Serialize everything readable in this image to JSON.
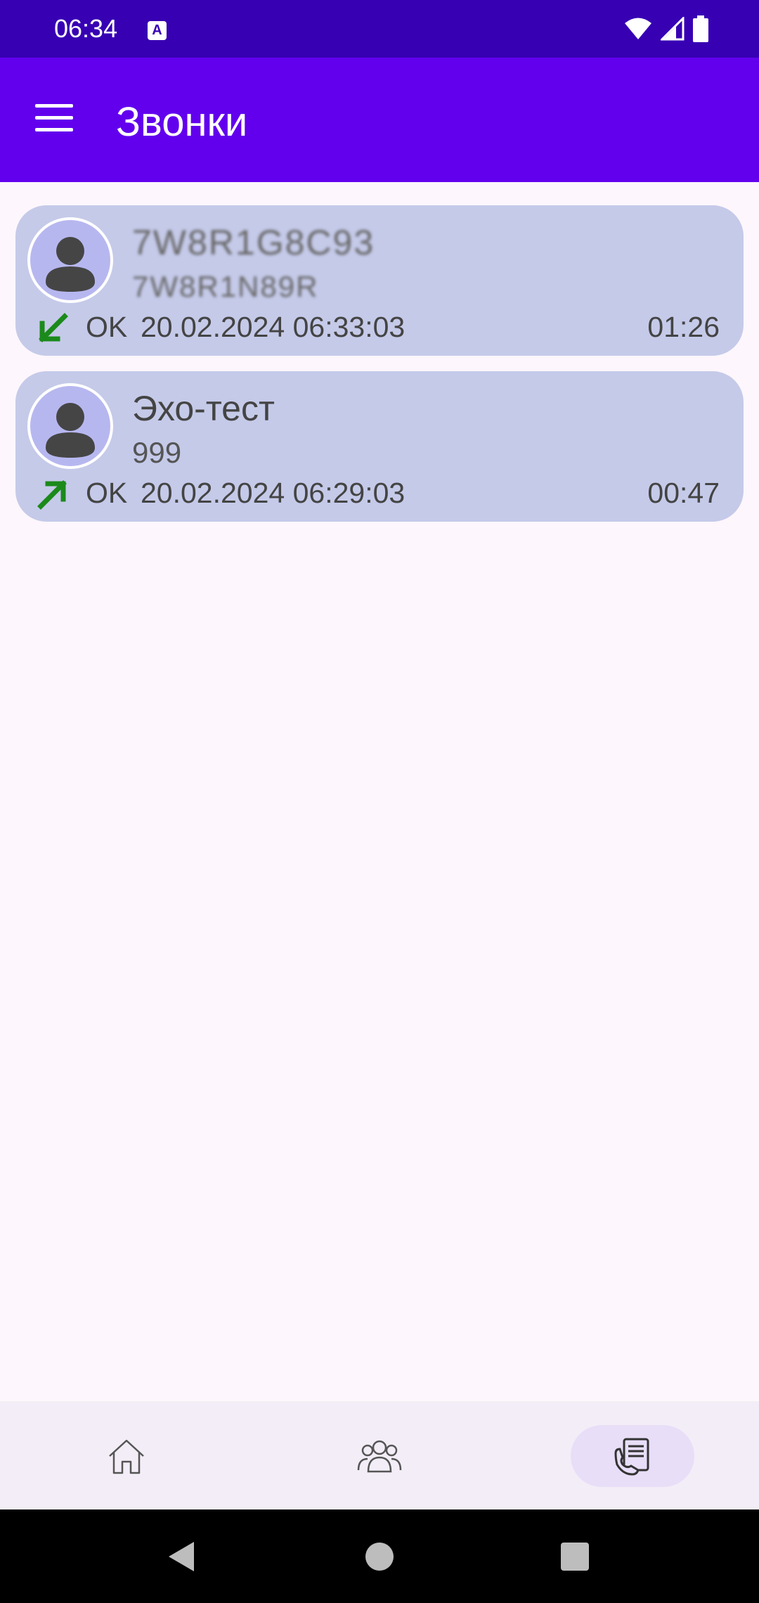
{
  "status_bar": {
    "time": "06:34",
    "icons": [
      "text-a-icon",
      "wifi-icon",
      "signal-icon",
      "battery-icon"
    ],
    "background": "#3700b3"
  },
  "app_bar": {
    "title": "Звонки",
    "menu_icon": "menu-icon",
    "background": "#6200ee"
  },
  "calls": [
    {
      "name": "7W8R1G8C93",
      "number": "7W8R1N89R",
      "direction": "incoming",
      "status": "OK",
      "datetime": "20.02.2024 06:33:03",
      "duration": "01:26"
    },
    {
      "name": "Эхо-тест",
      "number": "999",
      "direction": "outgoing",
      "status": "OK",
      "datetime": "20.02.2024 06:29:03",
      "duration": "00:47"
    }
  ],
  "bottom_nav": {
    "items": [
      {
        "icon": "home-icon",
        "selected": false
      },
      {
        "icon": "contacts-icon",
        "selected": false
      },
      {
        "icon": "call-log-icon",
        "selected": true
      }
    ]
  },
  "colors": {
    "card": "#c5cae9",
    "direction_arrow": "#1b8a1b",
    "page_bg": "#fdf6fc"
  }
}
